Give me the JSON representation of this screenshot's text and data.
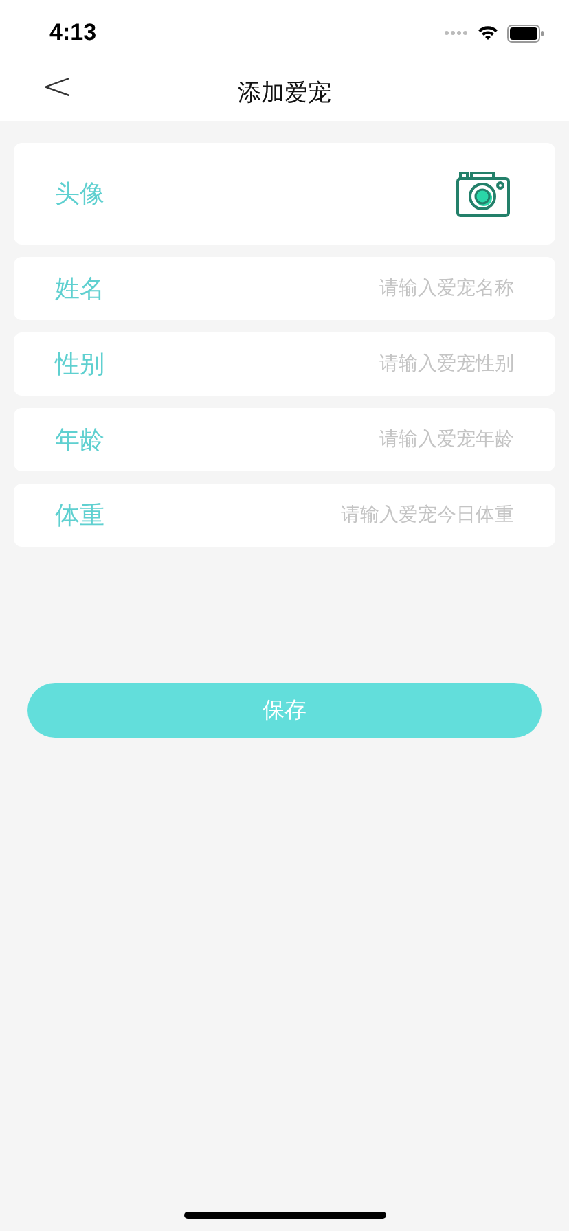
{
  "status_bar": {
    "time": "4:13"
  },
  "nav": {
    "back": "<",
    "title": "添加爱宠"
  },
  "avatar_row": {
    "label": "头像"
  },
  "fields": [
    {
      "label": "姓名",
      "placeholder": "请输入爱宠名称"
    },
    {
      "label": "性别",
      "placeholder": "请输入爱宠性别"
    },
    {
      "label": "年龄",
      "placeholder": "请输入爱宠年龄"
    },
    {
      "label": "体重",
      "placeholder": "请输入爱宠今日体重"
    }
  ],
  "save_button": {
    "label": "保存"
  }
}
